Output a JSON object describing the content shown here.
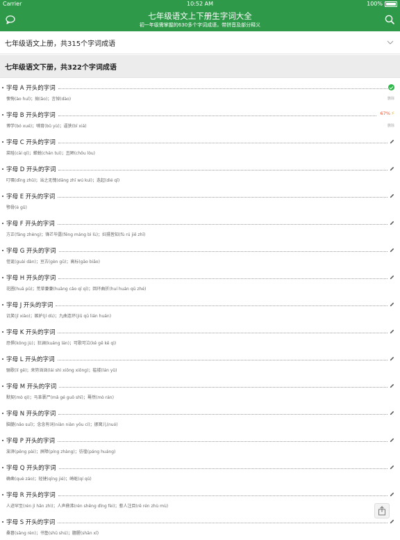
{
  "status_bar": {
    "carrier": "Carrier",
    "time": "10:52 AM",
    "battery": "100%"
  },
  "header": {
    "title": "七年级语文上下册生字词大全",
    "subtitle": "初一年级需掌握的630多个字词成语，带拼音及部分释义",
    "accent_color": "#2e9a49"
  },
  "sections": [
    {
      "label": "七年级语文上册，共315个字词成语"
    },
    {
      "label": "七年级语文下册，共322个字词成语"
    }
  ],
  "rows": [
    {
      "title": "字母 A 开头的字词",
      "words": "懊悔(ào huǐ)；拗(ǎo)；言悼(dào)",
      "status": "done",
      "side_badge": "删除"
    },
    {
      "title": "字母 B 开头的字词",
      "words": "博学(bó xué)；哺育(bǔ yù)；逼狭(bī xiá)",
      "status": "progress",
      "progress": "67%",
      "side_badge": "删除"
    },
    {
      "title": "字母 C 开头的字词",
      "words": "菜畦(cài qí)；蝉蜕(chán tuì)；丑陋(chǒu lòu)",
      "status": "edit"
    },
    {
      "title": "字母 D 开头的字词",
      "words": "叮嘱(dīng zhǔ)；当之无愧(dāng zhī wú kuì)；迭起(dié qǐ)",
      "status": "edit"
    },
    {
      "title": "字母 E 开头的字词",
      "words": "鄂骨(è gǔ)",
      "status": "edit"
    },
    {
      "title": "字母 F 开头的字词",
      "words": "方正(fāng zhèng)；锋芒毕露(fēng máng bì lù)；妇孺皆知(fù rú jiē zhī)",
      "status": "edit"
    },
    {
      "title": "字母 G 开头的字词",
      "words": "怪诞(guài dàn)；亘古(gèn gǔ)；高标(gāo biāo)",
      "status": "edit"
    },
    {
      "title": "字母 H 开头的字词",
      "words": "花圃(huā pǔ)；荒草萋萋(huāng cǎo qī qī)；回环曲折(huí huán qū zhé)",
      "status": "edit"
    },
    {
      "title": "字母 J 开头的字词",
      "words": "讥笑(jī xiào)；嫉妒(jí dù)；九曲连环(jiǔ qū lián huán)",
      "status": "edit"
    },
    {
      "title": "字母 K 开头的字词",
      "words": "恐惧(kǒng jù)；狂澜(kuáng lán)；可歌可泣(kě gē kě qì)",
      "status": "edit"
    },
    {
      "title": "字母 L 开头的字词",
      "words": "骊歌(lí gē)；来势汹汹(lái shì xiōng xiōng)；褴褛(lán yǔ)",
      "status": "edit"
    },
    {
      "title": "字母 M 开头的字词",
      "words": "默契(mò qì)；马革裹尸(mǎ gé guǒ shī)；蓦然(mò rán)",
      "status": "edit"
    },
    {
      "title": "字母 N 开头的字词",
      "words": "脑髓(nǎo suǐ)；念念有词(niàn niàn yǒu cí)；挪窝儿(nuó)",
      "status": "edit"
    },
    {
      "title": "字母 P 开头的字词",
      "words": "澎湃(pēng pài)；屏障(píng zhàng)；彷徨(páng huáng)",
      "status": "edit"
    },
    {
      "title": "字母 Q 开头的字词",
      "words": "确凿(què záo)；轻捷(qīng jié)；崎岖(qí qū)",
      "status": "edit"
    },
    {
      "title": "字母 R 开头的字词",
      "words": "人迹罕至(rén jì hǎn zhì)；人声鼎沸(rén shēng dǐng fèi)；惹人注目(rě rén zhù mù)",
      "status": "edit"
    },
    {
      "title": "字母 S 开头的字词",
      "words": "桑葚(sāng rèn)；书塾(shū shú)；膻腥(shān xī)",
      "status": "edit"
    }
  ]
}
